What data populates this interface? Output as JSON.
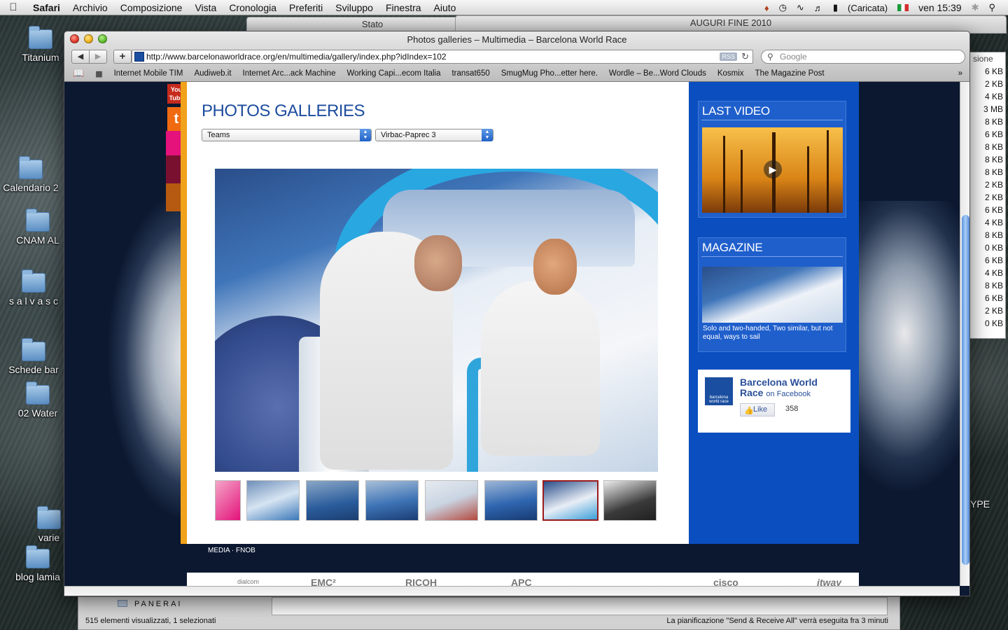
{
  "menubar": {
    "app": "Safari",
    "items": [
      "Archivio",
      "Composizione",
      "Vista",
      "Cronologia",
      "Preferiti",
      "Sviluppo",
      "Finestra",
      "Aiuto"
    ],
    "battery": "(Caricata)",
    "clock": "ven 15:39"
  },
  "background_windows": {
    "status_title": "Stato",
    "folder_title": "AUGURI FINE 2010"
  },
  "desktop_icons": [
    "Titanium",
    "Calendario 2",
    "CNAM AL",
    "s a l v a s c",
    "Schede bar",
    "02 Water",
    "varie",
    "blog lamia"
  ],
  "bg_list": {
    "header": "sione",
    "sizes": [
      "6 KB",
      "2 KB",
      "4 KB",
      "3 MB",
      "8 KB",
      "6 KB",
      "8 KB",
      "8 KB",
      "8 KB",
      "2 KB",
      "2 KB",
      "6 KB",
      "4 KB",
      "8 KB",
      "0 KB",
      "6 KB",
      "4 KB",
      "8 KB",
      "6 KB",
      "2 KB",
      "0 KB"
    ],
    "type_label": "YPE"
  },
  "safari": {
    "window_title": "Photos galleries – Multimedia – Barcelona World Race",
    "url": "http://www.barcelonaworldrace.org/en/multimedia/gallery/index.php?idIndex=102",
    "rss": "RSS",
    "search_placeholder": "Google",
    "bookmarks": [
      "Internet Mobile TIM",
      "Audiweb.it",
      "Internet Arc...ack Machine",
      "Working Capi...ecom Italia",
      "transat650",
      "SmugMug Pho...etter here.",
      "Wordle – Be...Word Clouds",
      "Kosmix",
      "The Magazine Post"
    ]
  },
  "page": {
    "title": "PHOTOS GALLERIES",
    "filter_category": "Teams",
    "filter_team": "Virbac-Paprec 3",
    "thumbnail_count": 8,
    "selected_thumbnail": 7,
    "youtube_label": "You Tube",
    "twitter_label": "t"
  },
  "sidebar": {
    "last_video_title": "LAST VIDEO",
    "magazine_title": "MAGAZINE",
    "magazine_caption": "Solo and two-handed, Two similar, but not equal, ways to sail"
  },
  "facebook": {
    "name_line1": "Barcelona World",
    "name_line2": "Race",
    "on_facebook": "on Facebook",
    "like_label": "Like",
    "like_count": "358",
    "logo_text": "barcelona world race"
  },
  "footer": {
    "links": "MEDIA · FNOB",
    "sponsors": [
      "dialcom",
      "EMC²",
      "RICOH",
      "APC",
      "",
      "cisco",
      "itway"
    ]
  },
  "finder": {
    "folder_name": "PANERAI",
    "status_left": "515 elementi visualizzati, 1 selezionati",
    "status_right": "La pianificazione \"Send & Receive All\" verrà eseguita fra 3 minuti"
  },
  "colors": {
    "site_blue": "#0a4ebf",
    "title_blue": "#1d4c9e",
    "accent_orange": "#f0a21a",
    "selected_thumb_border": "#9a1b1b"
  }
}
